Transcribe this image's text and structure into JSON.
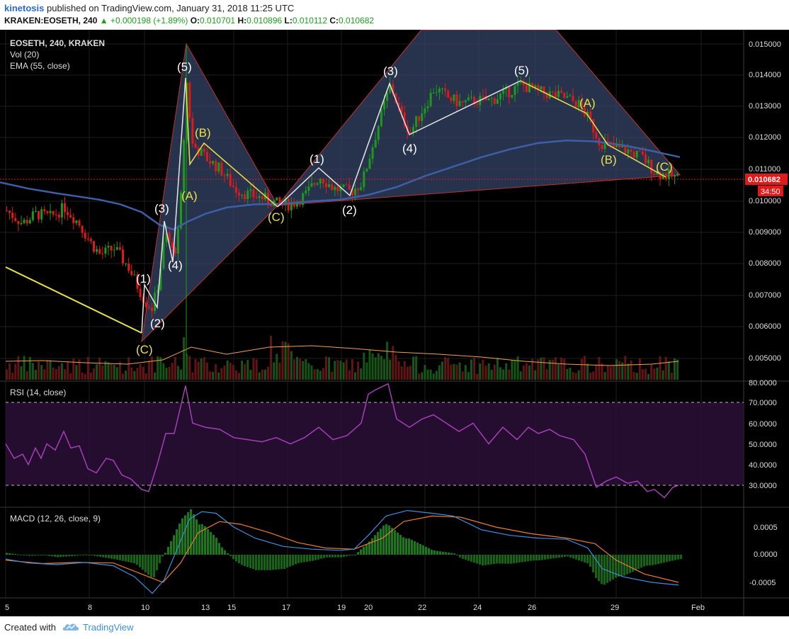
{
  "header": {
    "author": "kinetosis",
    "published": "published on TradingView.com, January 31, 2018 11:25 UTC",
    "symbol_tf": "KRAKEN:EOSETH, 240",
    "change": "▲ +0.000198 (+1.89%)",
    "o_label": "O:",
    "o_value": "0.010701",
    "h_label": "H:",
    "h_value": "0.010896",
    "l_label": "L:",
    "l_value": "0.010112",
    "c_label": "C:",
    "c_value": "0.010682"
  },
  "legend": {
    "symbol": "EOSETH, 240, KRAKEN",
    "vol": "Vol (20)",
    "ema": "EMA (55, close)",
    "rsi": "RSI (14, close)",
    "macd": "MACD (12, 26, close, 9)"
  },
  "price_axis": {
    "ticks": [
      "0.015000",
      "0.014000",
      "0.013000",
      "0.012000",
      "0.011000",
      "0.010000",
      "0.009000",
      "0.008000",
      "0.007000",
      "0.006000",
      "0.005000"
    ],
    "last_price": "0.010682",
    "countdown": "34:50"
  },
  "rsi_axis": {
    "ticks": [
      "80.0000",
      "70.0000",
      "60.0000",
      "50.0000",
      "40.0000",
      "30.0000"
    ]
  },
  "macd_axis": {
    "ticks": [
      "0.0005",
      "0.0000",
      "-0.0005"
    ]
  },
  "x_axis": {
    "ticks": [
      "5",
      "8",
      "10",
      "13",
      "15",
      "17",
      "19",
      "20",
      "22",
      "24",
      "26",
      "29",
      "Feb"
    ]
  },
  "wave_labels": {
    "c1": "(C)",
    "w1": "(1)",
    "w2": "(2)",
    "w3": "(3)",
    "w4": "(4)",
    "w5": "(5)",
    "a1": "(A)",
    "b1": "(B)",
    "c2": "(C)",
    "v1": "(1)",
    "v2": "(2)",
    "v3": "(3)",
    "v4": "(4)",
    "v5": "(5)",
    "a2": "(A)",
    "b2": "(B)",
    "c3": "(C)"
  },
  "footer": {
    "created": "Created with",
    "brand": "TradingView"
  },
  "colors": {
    "bull": "#1c9a1c",
    "bear": "#e0191a",
    "ema": "#3d5fa6",
    "rsi": "#a43fb8",
    "macd": "#3b8fe0",
    "signal": "#f07c2a",
    "wave_white": "#e6e6e6",
    "wave_yellow": "#e8e04a",
    "triangle_fill": "#38476e",
    "triangle_edge": "#c03030"
  },
  "chart_data": {
    "type": "candlestick",
    "title": "EOSETH, 240, KRAKEN",
    "ylim": [
      0.0045,
      0.0152
    ],
    "indicators": [
      "Vol (20)",
      "EMA (55, close)",
      "RSI (14, close)",
      "MACD (12, 26, close, 9)"
    ],
    "rsi_levels": [
      30,
      70
    ],
    "wave_points": [
      {
        "label": "(C)",
        "x": "Jan 9",
        "price": 0.0057
      },
      {
        "label": "(1)",
        "x": "Jan 10",
        "price": 0.0073
      },
      {
        "label": "(2)",
        "x": "Jan 10",
        "price": 0.0065
      },
      {
        "label": "(3)",
        "x": "Jan 11",
        "price": 0.0094
      },
      {
        "label": "(4)",
        "x": "Jan 11",
        "price": 0.0081
      },
      {
        "label": "(5)",
        "x": "Jan 12",
        "price": 0.0139
      },
      {
        "label": "(A)",
        "x": "Jan 13",
        "price": 0.0106
      },
      {
        "label": "(B)",
        "x": "Jan 13",
        "price": 0.0118
      },
      {
        "label": "(C)",
        "x": "Jan 16",
        "price": 0.0099
      },
      {
        "label": "(1)",
        "x": "Jan 18",
        "price": 0.011
      },
      {
        "label": "(2)",
        "x": "Jan 19",
        "price": 0.0102
      },
      {
        "label": "(3)",
        "x": "Jan 21",
        "price": 0.0138
      },
      {
        "label": "(4)",
        "x": "Jan 21",
        "price": 0.0121
      },
      {
        "label": "(5)",
        "x": "Jan 25",
        "price": 0.0138
      },
      {
        "label": "(A)",
        "x": "Jan 27",
        "price": 0.0128
      },
      {
        "label": "(B)",
        "x": "Jan 28",
        "price": 0.0117
      },
      {
        "label": "(C)",
        "x": "Jan 30",
        "price": 0.0108
      }
    ],
    "ema": [
      [
        0,
        0.0106
      ],
      [
        40,
        0.0104
      ],
      [
        80,
        0.01025
      ],
      [
        110,
        0.01015
      ],
      [
        140,
        0.01005
      ],
      [
        170,
        0.0099
      ],
      [
        200,
        0.00965
      ],
      [
        225,
        0.00925
      ],
      [
        245,
        0.0091
      ],
      [
        265,
        0.00935
      ],
      [
        290,
        0.0096
      ],
      [
        320,
        0.0098
      ],
      [
        360,
        0.0099
      ],
      [
        400,
        0.00992
      ],
      [
        440,
        0.01
      ],
      [
        480,
        0.01005
      ],
      [
        520,
        0.0102
      ],
      [
        560,
        0.01045
      ],
      [
        600,
        0.0108
      ],
      [
        640,
        0.0111
      ],
      [
        680,
        0.0114
      ],
      [
        720,
        0.01165
      ],
      [
        760,
        0.01185
      ],
      [
        800,
        0.01193
      ],
      [
        840,
        0.0119
      ],
      [
        880,
        0.01178
      ],
      [
        920,
        0.0116
      ],
      [
        960,
        0.0114
      ]
    ],
    "rsi": [
      [
        8,
        50
      ],
      [
        20,
        43
      ],
      [
        32,
        45
      ],
      [
        40,
        40
      ],
      [
        50,
        48
      ],
      [
        58,
        43
      ],
      [
        66,
        50
      ],
      [
        78,
        47
      ],
      [
        90,
        56
      ],
      [
        100,
        48
      ],
      [
        112,
        49
      ],
      [
        124,
        38
      ],
      [
        136,
        36
      ],
      [
        150,
        43
      ],
      [
        160,
        42
      ],
      [
        172,
        35
      ],
      [
        185,
        33
      ],
      [
        200,
        28
      ],
      [
        210,
        27
      ],
      [
        222,
        40
      ],
      [
        234,
        55
      ],
      [
        246,
        55
      ],
      [
        262,
        78
      ],
      [
        272,
        60
      ],
      [
        290,
        58
      ],
      [
        310,
        57
      ],
      [
        330,
        53
      ],
      [
        350,
        52
      ],
      [
        370,
        51
      ],
      [
        390,
        53
      ],
      [
        410,
        50
      ],
      [
        430,
        53
      ],
      [
        450,
        58
      ],
      [
        470,
        52
      ],
      [
        490,
        54
      ],
      [
        510,
        60
      ],
      [
        520,
        74
      ],
      [
        530,
        76
      ],
      [
        548,
        79
      ],
      [
        560,
        62
      ],
      [
        578,
        58
      ],
      [
        596,
        62
      ],
      [
        612,
        64
      ],
      [
        630,
        60
      ],
      [
        648,
        56
      ],
      [
        668,
        60
      ],
      [
        690,
        50
      ],
      [
        710,
        58
      ],
      [
        730,
        52
      ],
      [
        746,
        58
      ],
      [
        760,
        55
      ],
      [
        776,
        57
      ],
      [
        790,
        54
      ],
      [
        810,
        52
      ],
      [
        826,
        45
      ],
      [
        842,
        29
      ],
      [
        856,
        32
      ],
      [
        870,
        34
      ],
      [
        886,
        31
      ],
      [
        900,
        32
      ],
      [
        914,
        27
      ],
      [
        924,
        28
      ],
      [
        938,
        24
      ],
      [
        950,
        29
      ],
      [
        958,
        30
      ]
    ],
    "macd": [
      [
        8,
        -8e-05
      ],
      [
        40,
        -0.00015
      ],
      [
        80,
        -0.00018
      ],
      [
        120,
        -0.00014
      ],
      [
        160,
        -0.0002
      ],
      [
        190,
        -0.0004
      ],
      [
        215,
        -0.0007
      ],
      [
        232,
        -0.00045
      ],
      [
        250,
        0.0001
      ],
      [
        268,
        0.00065
      ],
      [
        285,
        0.00078
      ],
      [
        305,
        0.00075
      ],
      [
        330,
        0.0005
      ],
      [
        360,
        0.0003
      ],
      [
        400,
        0.00015
      ],
      [
        440,
        0.0001
      ],
      [
        480,
        8e-05
      ],
      [
        500,
        0.0001
      ],
      [
        520,
        0.00035
      ],
      [
        545,
        0.0007
      ],
      [
        575,
        0.0008
      ],
      [
        610,
        0.00075
      ],
      [
        640,
        0.0007
      ],
      [
        680,
        0.00045
      ],
      [
        720,
        0.00035
      ],
      [
        760,
        0.0003
      ],
      [
        800,
        0.00028
      ],
      [
        830,
        0.00012
      ],
      [
        850,
        -0.00025
      ],
      [
        880,
        -0.0004
      ],
      [
        920,
        -0.0005
      ],
      [
        958,
        -0.00055
      ]
    ],
    "signal": [
      [
        8,
        -0.0001
      ],
      [
        60,
        -0.00016
      ],
      [
        110,
        -0.00014
      ],
      [
        160,
        -0.00015
      ],
      [
        200,
        -0.00035
      ],
      [
        230,
        -0.0005
      ],
      [
        255,
        -0.00015
      ],
      [
        280,
        0.0004
      ],
      [
        310,
        0.0006
      ],
      [
        340,
        0.00055
      ],
      [
        380,
        0.0004
      ],
      [
        420,
        0.00022
      ],
      [
        460,
        0.00012
      ],
      [
        500,
        0.0001
      ],
      [
        540,
        0.0003
      ],
      [
        570,
        0.0006
      ],
      [
        610,
        0.0007
      ],
      [
        650,
        0.00068
      ],
      [
        700,
        0.0005
      ],
      [
        750,
        0.00038
      ],
      [
        800,
        0.0003
      ],
      [
        840,
        0.0002
      ],
      [
        870,
        -0.0001
      ],
      [
        910,
        -0.00035
      ],
      [
        958,
        -0.0005
      ]
    ]
  }
}
